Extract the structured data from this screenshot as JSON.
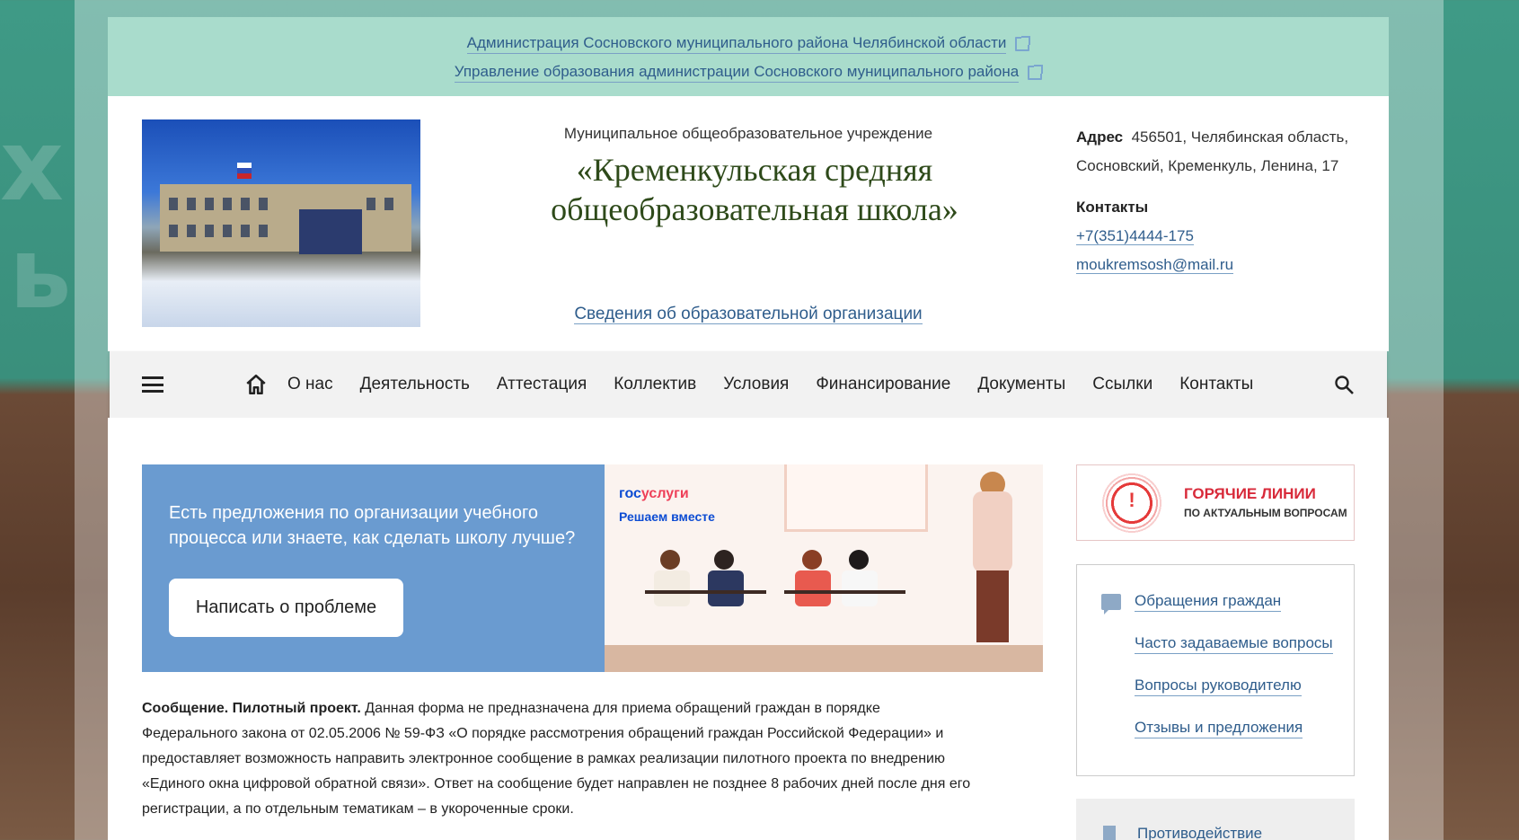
{
  "top_links": [
    "Администрация Сосновского муниципального района Челябинской области",
    "Управление образования администрации Сосновского муниципального района"
  ],
  "header": {
    "org_subtitle": "Муниципальное общеобразовательное учреждение",
    "org_title": "«Кременкульская средняя общеобразовательная школа»",
    "info_link": "Сведения об образовательной организации",
    "address_label": "Адрес",
    "address_line1": "456501, Челябинская область,",
    "address_line2": "Сосновский, Кременкуль, Ленина, 17",
    "contacts_label": "Контакты",
    "phone": "+7(351)4444-175",
    "email": "moukremsosh@mail.ru"
  },
  "nav": {
    "items": [
      "О нас",
      "Деятельность",
      "Аттестация",
      "Коллектив",
      "Условия",
      "Финансирование",
      "Документы",
      "Ссылки",
      "Контакты"
    ]
  },
  "banner": {
    "text": "Есть предложения по организации учебного процесса или знаете, как сделать школу лучше?",
    "button": "Написать о проблеме",
    "gos_part1": "гос",
    "gos_part2": "услуги",
    "gos_sub": "Решаем вместе"
  },
  "notice": {
    "bold": "Сообщение. Пилотный проект.",
    "text": " Данная форма не предназначена для приема обращений граждан в порядке Федерального закона от 02.05.2006 № 59-ФЗ «О порядке рассмотрения обращений граждан Российской Федерации» и предоставляет возможность направить электронное сообщение в рамках реализации пилотного проекта по внедрению «Единого окна цифровой обратной связи». Ответ на сообщение будет направлен не позднее 8 рабочих дней после дня его регистрации, а по отдельным тематикам – в укороченные сроки."
  },
  "hotline": {
    "title": "ГОРЯЧИЕ ЛИНИИ",
    "subtitle": "ПО АКТУАЛЬНЫМ ВОПРОСАМ"
  },
  "side_links": [
    "Обращения граждан",
    "Часто задаваемые вопросы",
    "Вопросы руководителю",
    "Отзывы и предложения"
  ],
  "side_box2": "Противодействие",
  "colors": {
    "top_bar": "#a9dccc",
    "link": "#2f5d8c",
    "banner": "#6a9bd0",
    "hotline_red": "#d82a3a"
  }
}
